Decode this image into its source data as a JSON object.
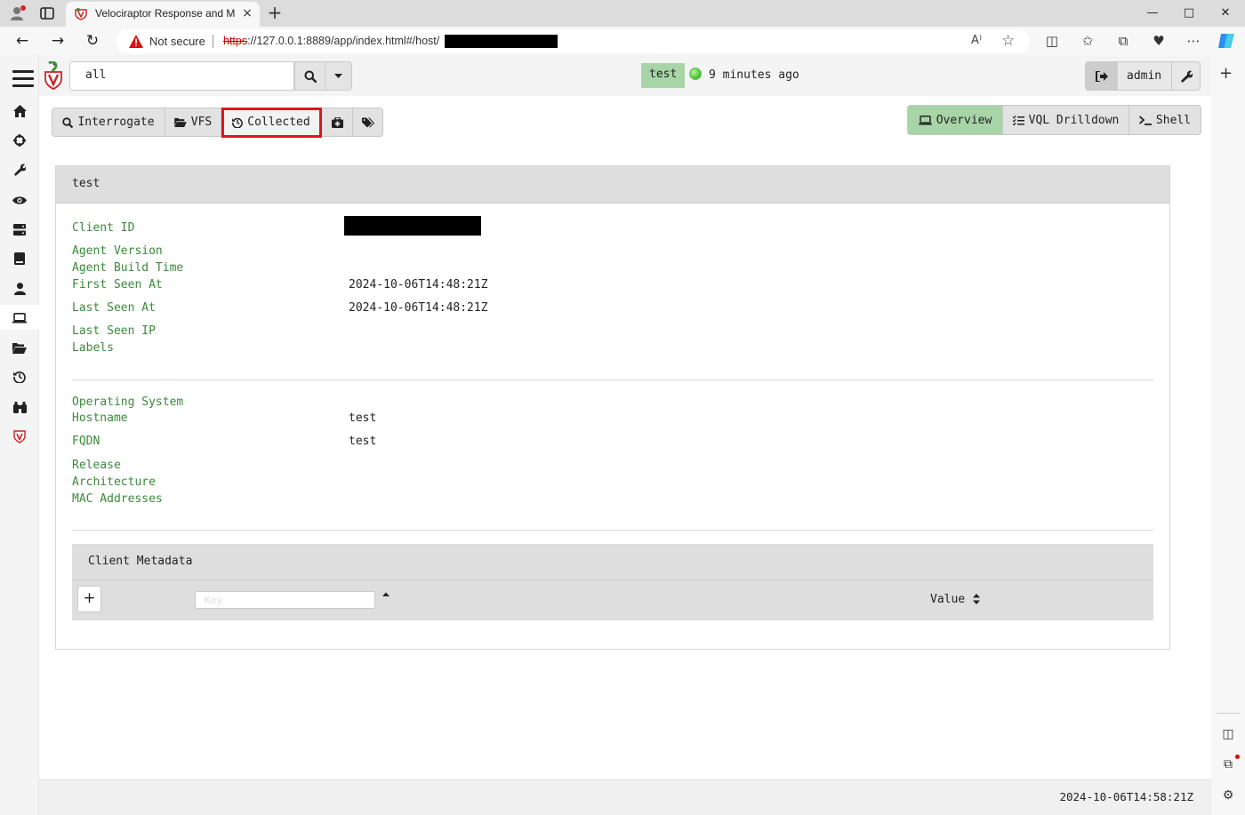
{
  "browser": {
    "tab_title": "Velociraptor Response and Monitoring",
    "tab_close": "×",
    "new_tab": "+",
    "not_secure_label": "Not secure",
    "url_scheme": "https",
    "url_rest": "://127.0.0.1:8889/app/index.html#/host/",
    "read_aloud": "A⁾",
    "window_controls": {
      "minimize": "—",
      "maximize": "□",
      "close": "✕"
    }
  },
  "app": {
    "search": {
      "value": "all"
    },
    "client_badge": "test",
    "last_seen": "9 minutes ago",
    "user": {
      "name": "admin"
    },
    "toolbar": {
      "interrogate": "Interrogate",
      "vfs": "VFS",
      "collected": "Collected"
    },
    "views": {
      "overview": "Overview",
      "vql_drilldown": "VQL Drilldown",
      "shell": "Shell"
    },
    "card": {
      "title": "test",
      "fields_agent": [
        {
          "label": "Client ID",
          "value": ""
        },
        {
          "label": "Agent Version",
          "value": ""
        },
        {
          "label": "Agent Build Time",
          "value": ""
        },
        {
          "label": "First Seen At",
          "value": "2024-10-06T14:48:21Z"
        },
        {
          "label": "Last Seen At",
          "value": "2024-10-06T14:48:21Z"
        },
        {
          "label": "Last Seen IP",
          "value": ""
        },
        {
          "label": "Labels",
          "value": ""
        }
      ],
      "fields_os": [
        {
          "label": "Operating System",
          "value": ""
        },
        {
          "label": "Hostname",
          "value": "test"
        },
        {
          "label": "FQDN",
          "value": "test"
        },
        {
          "label": "Release",
          "value": ""
        },
        {
          "label": "Architecture",
          "value": ""
        },
        {
          "label": "MAC Addresses",
          "value": ""
        }
      ]
    },
    "metadata": {
      "title": "Client Metadata",
      "add_label": "+",
      "key_placeholder": "Key",
      "value_header": "Value"
    },
    "footer_time": "2024-10-06T14:58:21Z"
  },
  "colors": {
    "label_green": "#3a8a3a",
    "badge_green": "#a8d5a8",
    "highlight_red": "#e0141e",
    "online_green": "#3fbf2a"
  },
  "icons": {
    "sidebar": [
      "home-icon",
      "crosshair-icon",
      "wrench-icon",
      "eye-icon",
      "server-icon",
      "book-icon",
      "user-icon",
      "laptop-icon",
      "folder-open-icon",
      "history-icon",
      "binoculars-icon",
      "velociraptor-shield-icon"
    ]
  }
}
